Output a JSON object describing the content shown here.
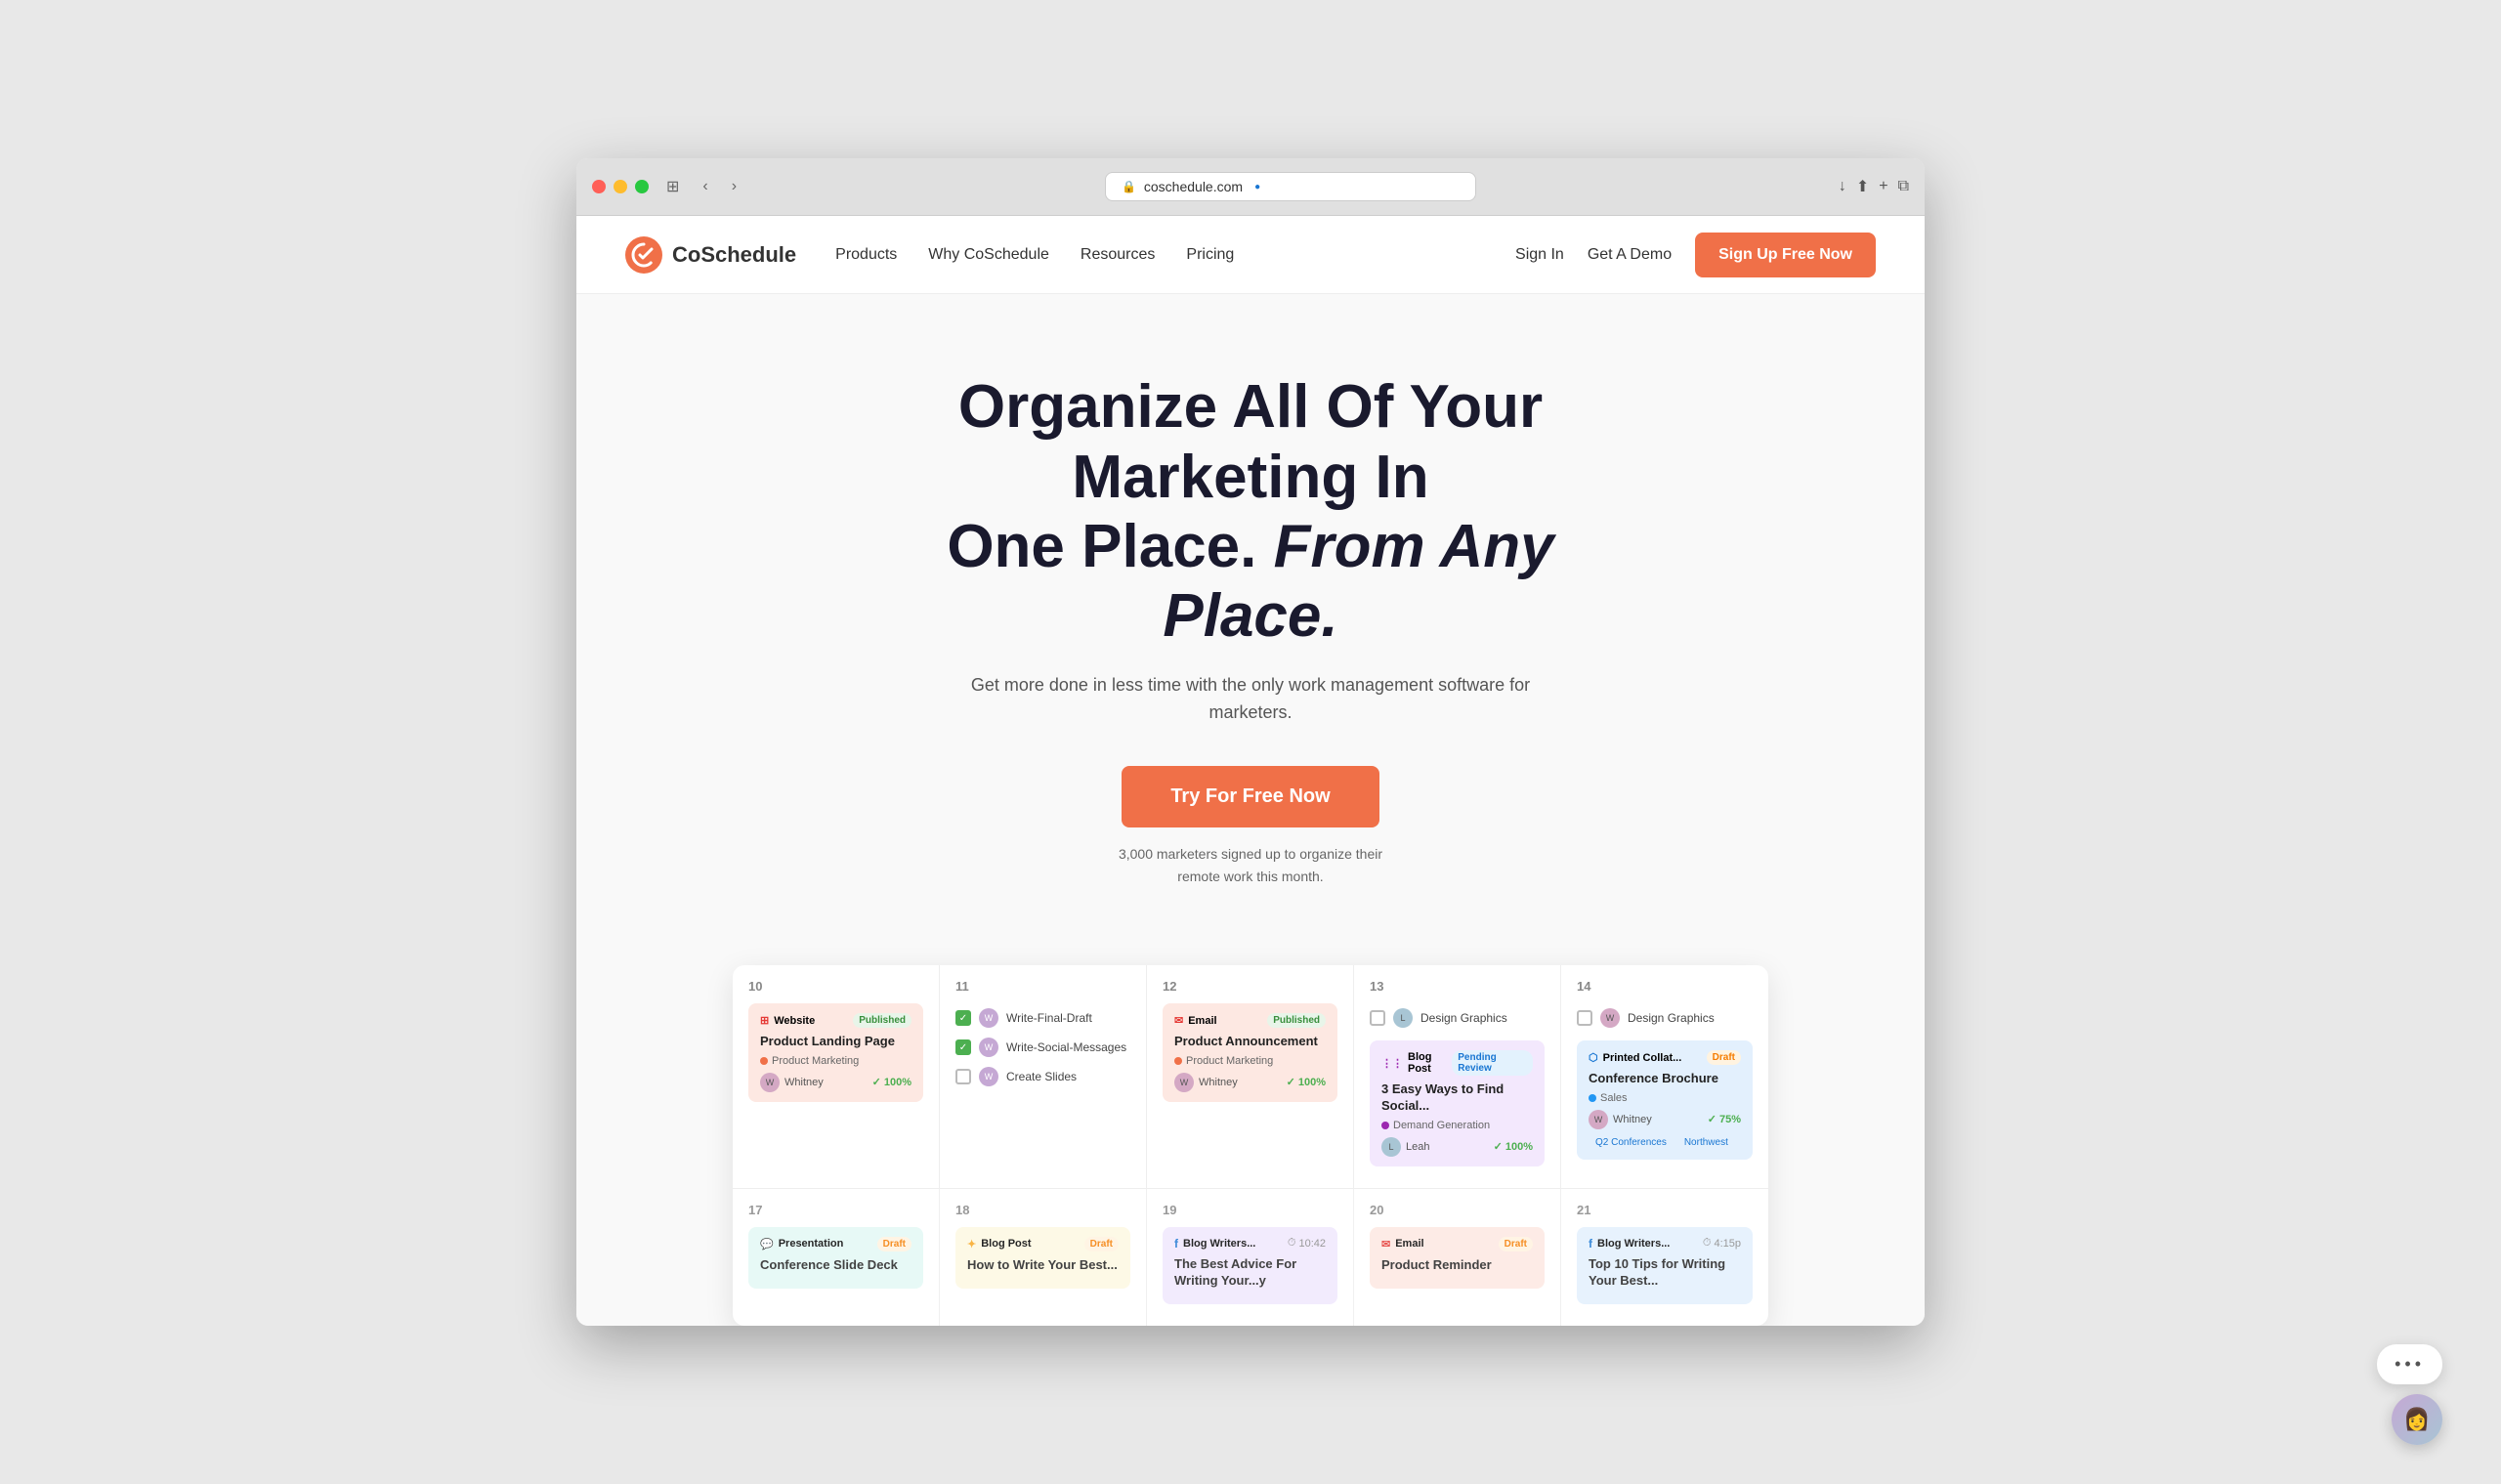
{
  "browser": {
    "url": "coschedule.com",
    "back_btn": "‹",
    "forward_btn": "›"
  },
  "nav": {
    "logo_text": "CoSchedule",
    "links": [
      {
        "label": "Products",
        "id": "products"
      },
      {
        "label": "Why CoSchedule",
        "id": "why"
      },
      {
        "label": "Resources",
        "id": "resources"
      },
      {
        "label": "Pricing",
        "id": "pricing"
      }
    ],
    "sign_in": "Sign In",
    "get_demo": "Get A Demo",
    "signup_btn": "Sign Up Free Now"
  },
  "hero": {
    "headline_1": "Organize All Of Your Marketing In",
    "headline_2": "One Place. ",
    "headline_italic": "From Any Place.",
    "subtitle": "Get more done in less time with the only work management software for marketers.",
    "cta_btn": "Try For Free Now",
    "cta_note_1": "3,000 marketers signed up to organize their",
    "cta_note_2": "remote work this month."
  },
  "calendar": {
    "rows": [
      {
        "days": [
          {
            "number": "10",
            "cards": [
              {
                "type": "website",
                "type_label": "Website",
                "badge": "Published",
                "badge_class": "badge-published",
                "color": "card-website",
                "title": "Product Landing Page",
                "tag": "Product Marketing",
                "tag_color": "#f07048",
                "assignee": "Whitney",
                "progress": "✓ 100%"
              }
            ]
          },
          {
            "number": "11",
            "tasks": [
              {
                "checked": true,
                "label": "Write-Final-Draft"
              },
              {
                "checked": true,
                "label": "Write-Social-Messages"
              },
              {
                "checked": false,
                "label": "Create Slides"
              }
            ]
          },
          {
            "number": "12",
            "cards": [
              {
                "type": "email",
                "type_label": "Email",
                "badge": "Published",
                "badge_class": "badge-published",
                "color": "card-email",
                "title": "Product Announcement",
                "tag": "Product Marketing",
                "tag_color": "#f07048",
                "assignee": "Whitney",
                "progress": "✓ 100%"
              }
            ]
          },
          {
            "number": "13",
            "top_task": {
              "label": "Design Graphics",
              "assignee": "L"
            },
            "cards": [
              {
                "type": "blog",
                "type_label": "Blog Post",
                "badge": "Pending Review",
                "badge_class": "badge-pending",
                "color": "card-blog",
                "title": "3 Easy Ways to Find Social...",
                "tag": "Demand Generation",
                "tag_color": "#9c27b0",
                "assignee": "Leah",
                "progress": "✓ 100%"
              }
            ]
          },
          {
            "number": "14",
            "top_task": {
              "label": "Design Graphics",
              "assignee": "W"
            },
            "cards": [
              {
                "type": "collateral",
                "type_label": "Printed Collat...",
                "badge": "Draft",
                "badge_class": "badge-draft",
                "color": "card-collateral",
                "title": "Conference Brochure",
                "tag": "Sales",
                "tag_color": "#2196f3",
                "assignee": "Whitney",
                "progress": "✓ 75%",
                "tags": [
                  "Q2 Conferences",
                  "Northwest"
                ]
              }
            ]
          }
        ]
      },
      {
        "days": [
          {
            "number": "17",
            "cards": [
              {
                "type": "presentation",
                "type_label": "Presentation",
                "badge": "Draft",
                "badge_class": "badge-draft",
                "color": "card-presentation",
                "title": "Conference Slide Deck",
                "tag": "",
                "assignee": "",
                "progress": ""
              }
            ]
          },
          {
            "number": "18",
            "cards": [
              {
                "type": "blog",
                "type_label": "Blog Post",
                "badge": "Draft",
                "badge_class": "badge-draft",
                "color": "card-blog-yellow",
                "title": "How to Write Your Best...",
                "tag": "",
                "assignee": "",
                "progress": ""
              }
            ]
          },
          {
            "number": "19",
            "cards": [
              {
                "type": "blog-writers",
                "type_label": "Blog Writers...",
                "time": "10:42",
                "badge": "",
                "badge_class": "",
                "color": "card-blog-purple",
                "title": "The Best Advice For Writing Your...y",
                "tag": "",
                "assignee": "",
                "progress": ""
              }
            ]
          },
          {
            "number": "20",
            "cards": [
              {
                "type": "email",
                "type_label": "Email",
                "badge": "Draft",
                "badge_class": "badge-draft",
                "color": "card-email-orange",
                "title": "Product Reminder",
                "tag": "",
                "assignee": "",
                "progress": ""
              }
            ]
          },
          {
            "number": "21",
            "cards": [
              {
                "type": "blog-writers",
                "type_label": "Blog Writers...",
                "time": "4:15p",
                "badge": "",
                "badge_class": "",
                "color": "card-blog-blue",
                "title": "Top 10 Tips for Writing Your Best...",
                "tag": "",
                "assignee": "",
                "progress": ""
              }
            ]
          }
        ]
      }
    ]
  },
  "chat": {
    "dots": "•••"
  }
}
